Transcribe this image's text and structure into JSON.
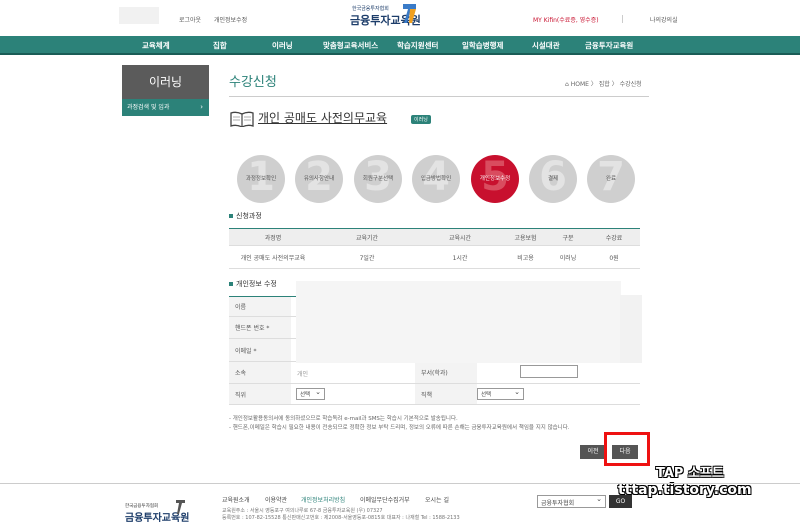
{
  "top": {
    "links": [
      "로그아웃",
      "개인정보수정"
    ],
    "brand_small": "한국금융투자협회",
    "brand_big": "금융투자교육원",
    "my_kifin": "MY Kifin(수료증, 영수증)",
    "my_lecture": "나의강의실"
  },
  "nav": [
    "교육체계",
    "집합",
    "이러닝",
    "맞춤형교육서비스",
    "학습지원센터",
    "일학습병행제",
    "시설대관",
    "금융투자교육원"
  ],
  "sidebar": {
    "title": "이러닝",
    "item": "과정검색 및 입과",
    "chevron": "›"
  },
  "page": {
    "title": "수강신청",
    "breadcrumb": "HOME 〉 집합 〉 수강신청",
    "course_title": "개인 공매도 사전의무교육",
    "course_badge": "이러닝"
  },
  "steps": [
    {
      "num": "1",
      "label": "과정정보확인"
    },
    {
      "num": "2",
      "label": "유의사항안내"
    },
    {
      "num": "3",
      "label": "회원구분선택"
    },
    {
      "num": "4",
      "label": "입금방법확인"
    },
    {
      "num": "5",
      "label": "개인정보수정"
    },
    {
      "num": "6",
      "label": "결제"
    },
    {
      "num": "7",
      "label": "완료"
    }
  ],
  "section_course": "신청과정",
  "course_table": {
    "headers": [
      "과정명",
      "교육기간",
      "교육시간",
      "고용보험",
      "구분",
      "수강료"
    ],
    "row": [
      "개인 공매도 사전의무교육",
      "7일간",
      "1시간",
      "비고용",
      "이러닝",
      "0원"
    ]
  },
  "section_info": "개인정보 수정",
  "form": {
    "name_label": "이름",
    "phone_label": "핸드폰 번호 *",
    "email_label": "이메일 *",
    "org_label": "소속",
    "org_value": "개인",
    "dept_label": "부서(학과)",
    "position_label": "직위",
    "position_select": "선택",
    "duty_label": "직책",
    "duty_select": "선택"
  },
  "notices": [
    "- 개인정보활용동의서에 동의하셨으므로 학습독려 e-mail과 SMS는 학습시 기본적으로 발송됩니다.",
    "- 핸드폰,이메일은 학습시 필요한 내용이 전송되므로 정확한 정보 부탁 드리며, 정보의 오류에 따른 손해는 금융투자교육원에서 책임을 지지 않습니다."
  ],
  "buttons": {
    "prev": "이전",
    "next": "다음"
  },
  "watermark": {
    "line1": "TAP 소프트",
    "line2": "tttap.tistory.com"
  },
  "footer": {
    "brand_small": "한국금융투자협회",
    "brand_big": "금융투자교육원",
    "links": [
      "교육원소개",
      "이용약관",
      "개인정보처리방침",
      "이메일무단수집거부",
      "오시는 길"
    ],
    "addr1": "교육원주소 : 서울시 영등포구 여의나루로 67-8 금융투자교육원 (우) 07327",
    "addr2": "등록번호 : 107-82-15528 통신판매신고번호 : 제2008-서울영등포-0815호 대표자 : 나재철  Tel : 1588-2133",
    "select": "금융투자협회",
    "go": "GO"
  },
  "colors": {
    "accent": "#2c8279",
    "active_step": "#c8102e",
    "highlight": "#ee1111"
  }
}
